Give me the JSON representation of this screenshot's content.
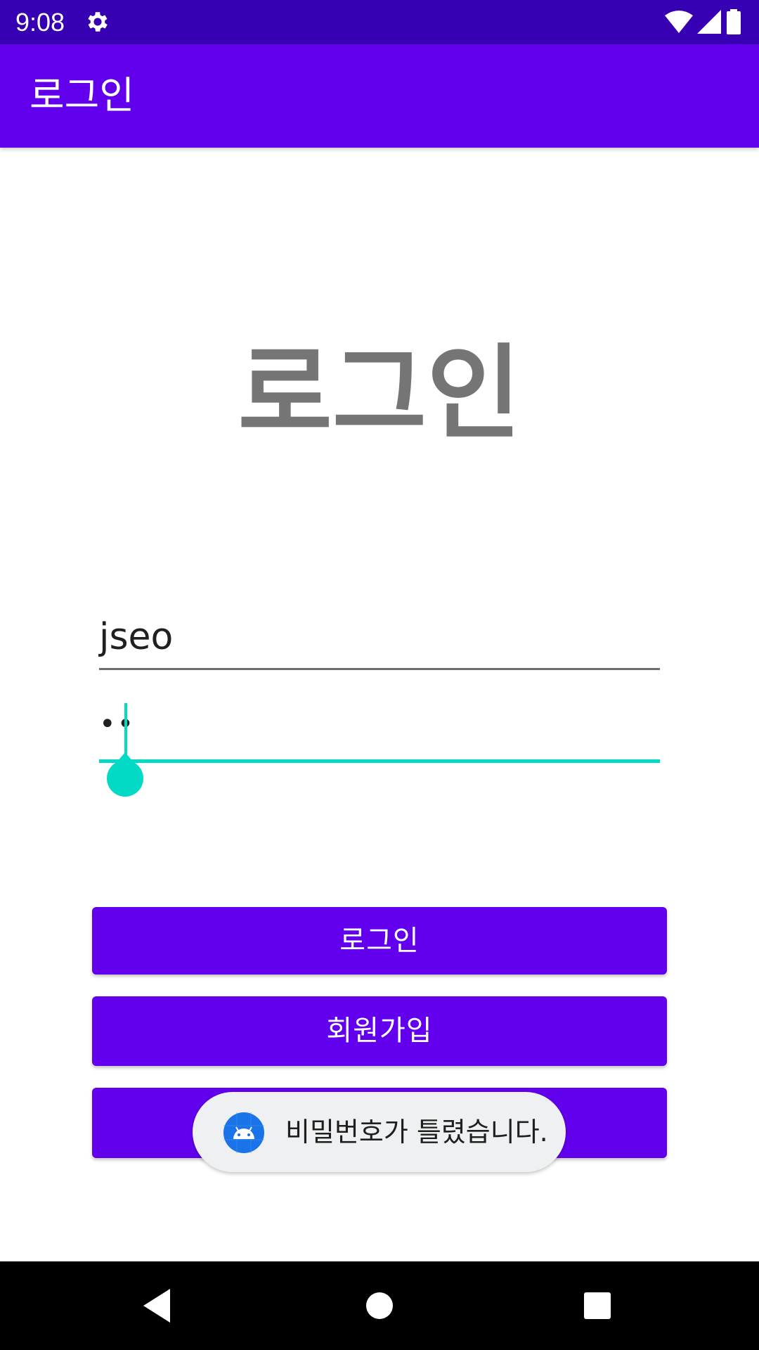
{
  "status_bar": {
    "time": "9:08",
    "icons": [
      "gear-icon",
      "wifi-icon",
      "signal-icon",
      "battery-icon"
    ]
  },
  "app_bar": {
    "title": "로그인"
  },
  "main": {
    "heading": "로그인",
    "id_field": {
      "value": "jseo"
    },
    "password_field": {
      "masked_value": "••"
    },
    "buttons": {
      "login_label": "로그인",
      "signup_label": "회원가입",
      "third_label": ""
    }
  },
  "toast": {
    "message": "비밀번호가 틀렸습니다.",
    "icon": "android-icon"
  },
  "nav_bar": {
    "icons": [
      "back-icon",
      "home-icon",
      "recents-icon"
    ]
  },
  "colors": {
    "status_bar": "#3700b3",
    "app_bar": "#6200ee",
    "primary_button": "#6200ee",
    "accent": "#03dac5",
    "heading_text": "#757575",
    "toast_background": "#eff0f2"
  }
}
